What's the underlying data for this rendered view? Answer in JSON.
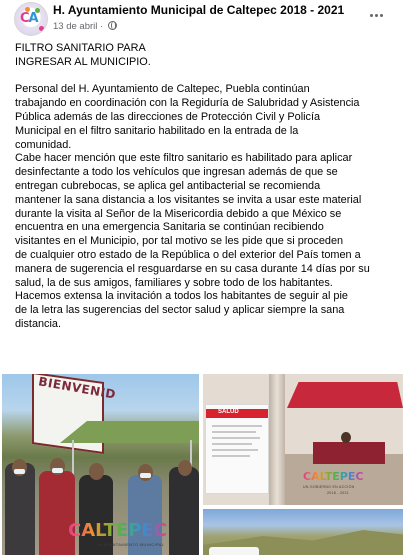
{
  "post": {
    "page_name": "H. Ayuntamiento Municipal de Caltepec 2018 - 2021",
    "date": "13 de abril",
    "separator": "·",
    "privacy_icon": "globe-icon",
    "more_icon": "more-options-icon"
  },
  "text": {
    "title_line1": "FILTRO SANITARIO PARA",
    "title_line2": "INGRESAR AL MUNICIPIO.",
    "lines": [
      "Personal del H. Ayuntamiento de Caltepec, Puebla continúan",
      "trabajando en coordinación con la Regiduría de Salubridad y Asistencia",
      "Pública además de las direcciones de Protección Civil y Policía",
      "Municipal en el filtro sanitario habilitado en la entrada de la",
      "comunidad.",
      "Cabe hacer mención que este filtro sanitario es habilitado para aplicar",
      "desinfectante a todo los vehículos que ingresan además de que se",
      "entregan cubrebocas, se aplica gel antibacterial se recomienda",
      "mantener la sana distancia a los visitantes se invita a usar este material",
      "durante la visita al Señor de la Misericordia debido a que México se",
      "encuentra en una emergencia Sanitaria se continúan recibiendo",
      "visitantes en el Municipio, por tal motivo se les pide que si proceden",
      "de cualquier otro estado de la República o del exterior del País tomen a",
      "manera de sugerencia el resguardarse en su casa durante 14 días por su",
      "salud, la de sus amigos, familiares y sobre todo de los habitantes.",
      "Hacemos extensa la invitación a todos los habitantes de seguir al pie",
      "de la letra las sugerencias del sector salud y aplicar siempre la sana",
      "distancia."
    ]
  },
  "photos": {
    "main_sign": "BIENVENID",
    "main_watermark": "CALTEPEC",
    "main_watermark_sub": "H. AYUNTAMIENTO MUNICIPAL",
    "tr_poster_title": "SALUD",
    "tr_watermark": "CALTEPEC",
    "tr_watermark_sub": "UN GOBIERNO EN ACCIÓN",
    "tr_watermark_years": "2018 - 2021"
  },
  "colors": {
    "text": "#050505",
    "secondary": "#65676b",
    "watermark_pink": "#e23c8d",
    "watermark_blue": "#2f93d6",
    "watermark_green": "#5fb33c",
    "watermark_orange": "#f0912b"
  }
}
